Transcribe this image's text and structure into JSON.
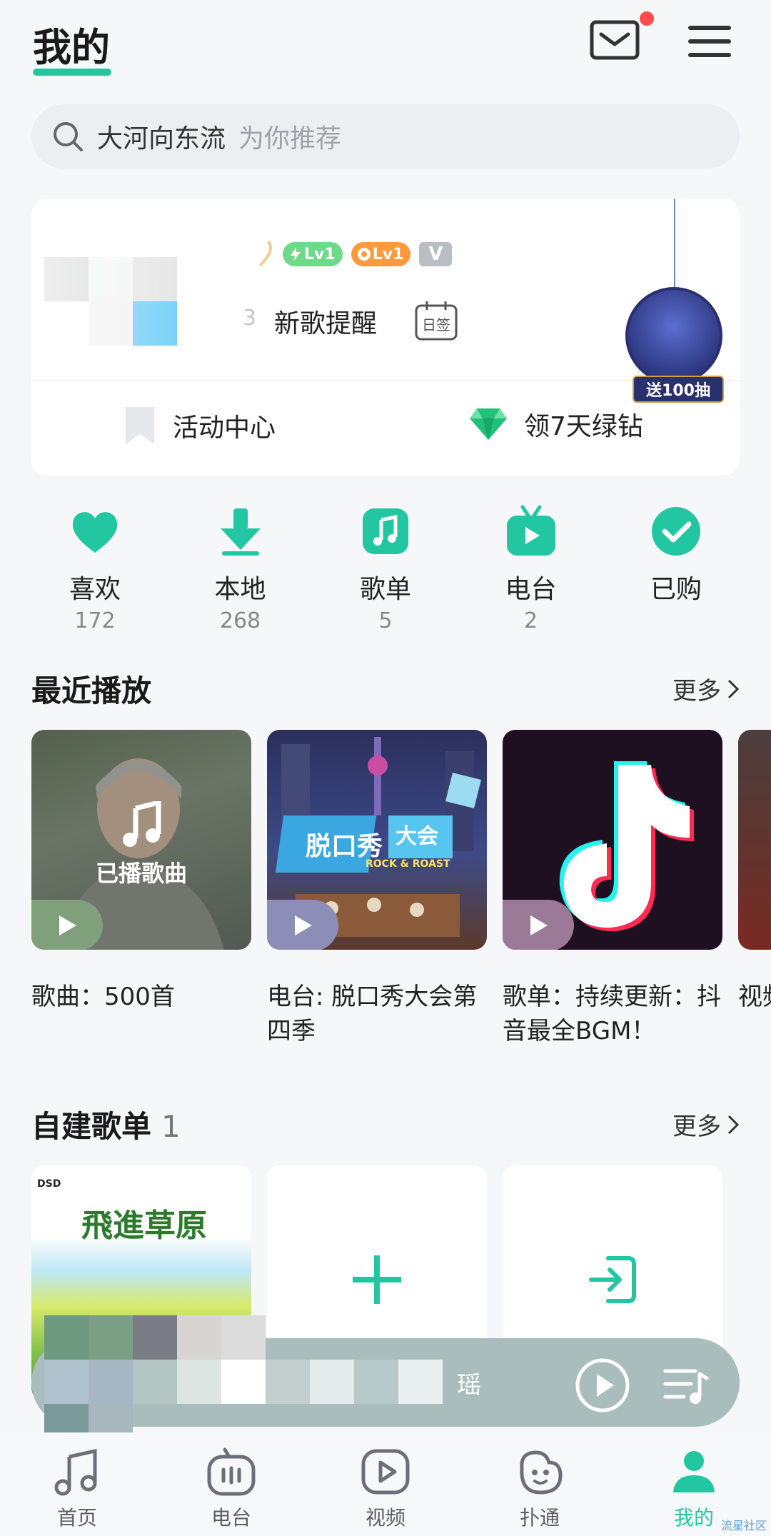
{
  "header": {
    "title": "我的"
  },
  "search": {
    "keyword": "大河向东流",
    "hint": "为你推荐"
  },
  "profile": {
    "badges": [
      "Lv1",
      "Lv1"
    ],
    "digit": "3",
    "new_song_label": "新歌提醒",
    "daily_sign_label": "日签",
    "activity_label": "活动中心",
    "vip_label": "领7天绿钻",
    "pendant_tag": "送100抽"
  },
  "quick": [
    {
      "label": "喜欢",
      "count": "172",
      "icon": "heart-icon"
    },
    {
      "label": "本地",
      "count": "268",
      "icon": "download-icon"
    },
    {
      "label": "歌单",
      "count": "5",
      "icon": "music-note-icon"
    },
    {
      "label": "电台",
      "count": "2",
      "icon": "radio-icon"
    },
    {
      "label": "已购",
      "count": "",
      "icon": "check-icon"
    }
  ],
  "recent": {
    "title": "最近播放",
    "more": "更多",
    "tiles": [
      {
        "overlay": "已播歌曲",
        "caption": "歌曲：500首"
      },
      {
        "overlay_main": "脱口秀",
        "overlay_side": "大会",
        "overlay_sub": "ROCK & ROAST",
        "caption": "电台: 脱口秀大会第四季"
      },
      {
        "caption": "歌单：持续更新：抖音最全BGM！"
      },
      {
        "caption": "视频"
      }
    ]
  },
  "playlists": {
    "title": "自建歌单",
    "count": "1",
    "more": "更多",
    "cover_text": "飛進草原",
    "cover_top": "DSD"
  },
  "player": {
    "lyric": "瑶"
  },
  "nav": [
    {
      "label": "首页",
      "icon": "music-home-icon"
    },
    {
      "label": "电台",
      "icon": "radio-nav-icon"
    },
    {
      "label": "视频",
      "icon": "video-icon"
    },
    {
      "label": "扑通",
      "icon": "putong-icon"
    },
    {
      "label": "我的",
      "icon": "profile-icon",
      "active": true
    }
  ],
  "watermark": "流星社区",
  "colors": {
    "accent": "#22c7a1",
    "notification": "#ff4c4c"
  }
}
